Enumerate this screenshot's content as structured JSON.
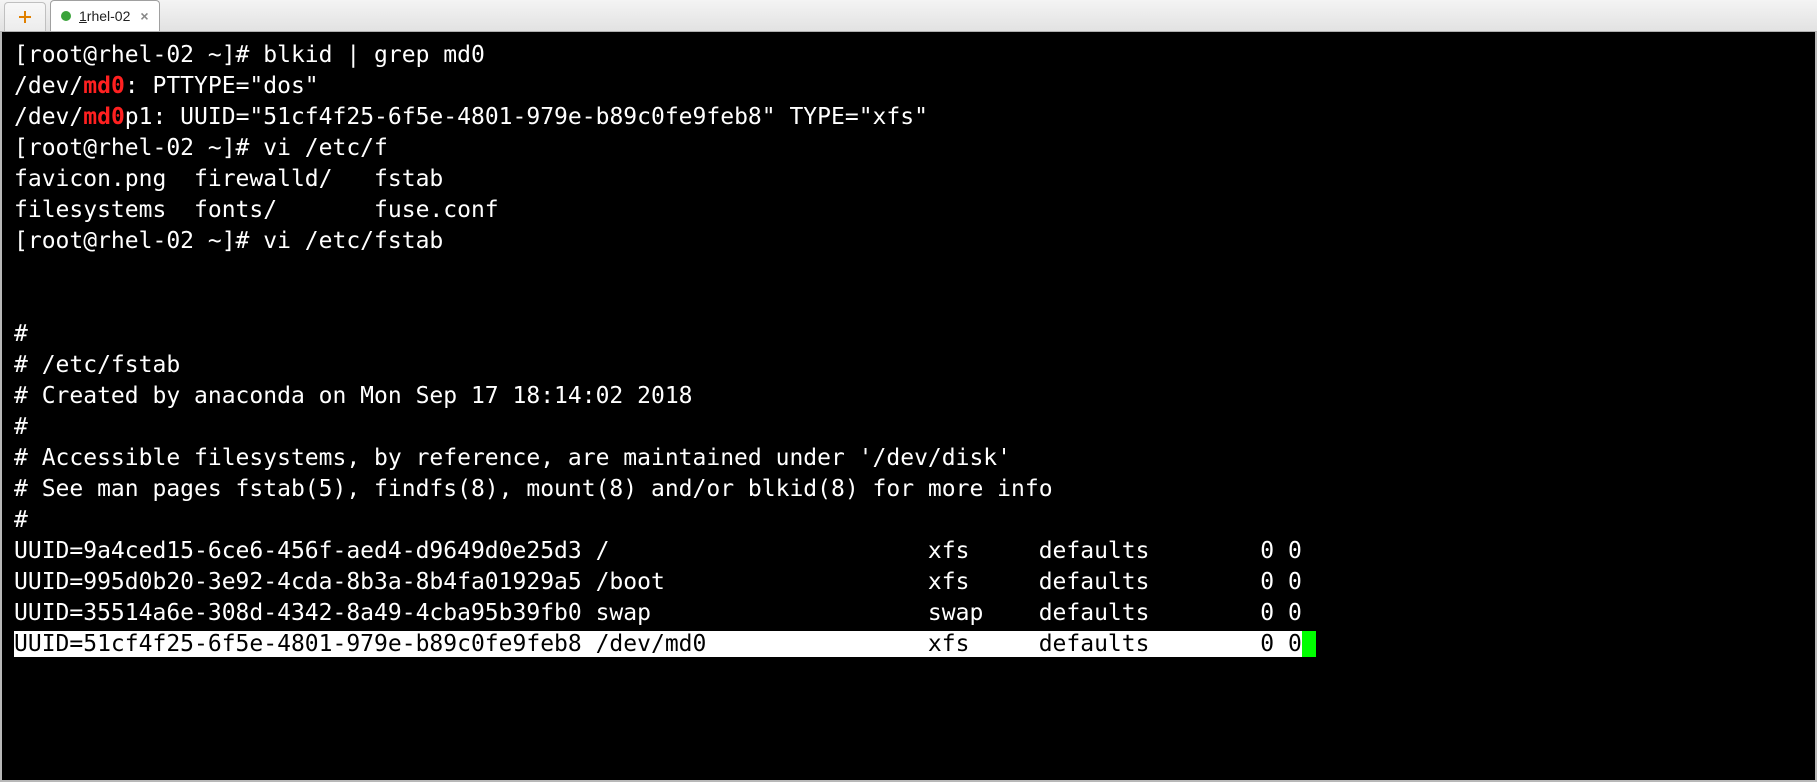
{
  "tab": {
    "num": "1",
    "title": " rhel-02"
  },
  "term": {
    "prompt": "[root@rhel-02 ~]# ",
    "cmd1": "blkid | grep md0",
    "line2_a": "/dev/",
    "line2_h": "md0",
    "line2_b": ": PTTYPE=\"dos\"",
    "line3_a": "/dev/",
    "line3_h": "md0",
    "line3_b": "p1: UUID=\"51cf4f25-6f5e-4801-979e-b89c0fe9feb8\" TYPE=\"xfs\"",
    "cmd2": "vi /etc/f",
    "line5": "favicon.png  firewalld/   fstab",
    "line6": "filesystems  fonts/       fuse.conf",
    "cmd3": "vi /etc/fstab",
    "blank": "",
    "c1": "#",
    "c2": "# /etc/fstab",
    "c3": "# Created by anaconda on Mon Sep 17 18:14:02 2018",
    "c4": "#",
    "c5": "# Accessible filesystems, by reference, are maintained under '/dev/disk'",
    "c6": "# See man pages fstab(5), findfs(8), mount(8) and/or blkid(8) for more info",
    "c7": "#",
    "f1": "UUID=9a4ced15-6ce6-456f-aed4-d9649d0e25d3 /                       xfs     defaults        0 0",
    "f2": "UUID=995d0b20-3e92-4cda-8b3a-8b4fa01929a5 /boot                   xfs     defaults        0 0",
    "f3": "UUID=35514a6e-308d-4342-8a49-4cba95b39fb0 swap                    swap    defaults        0 0",
    "f4_a": "UUID=51cf4f25-6f5e-4801-979e-b89c0fe9feb8 /dev/md0                xfs     defaults        0 0",
    "f4_cursor": " "
  }
}
